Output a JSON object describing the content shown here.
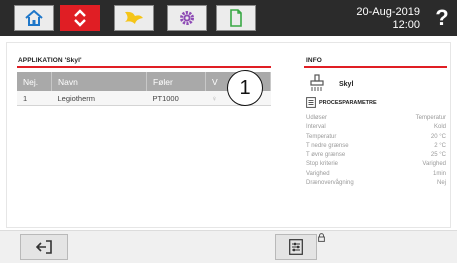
{
  "header": {
    "date": "20-Aug-2019",
    "time": "12:00",
    "help_label": "?",
    "tabs": [
      {
        "icon": "home-icon"
      },
      {
        "icon": "swap-arrows-icon",
        "active": true
      },
      {
        "icon": "flame-icon"
      },
      {
        "icon": "gear-icon"
      },
      {
        "icon": "document-icon"
      }
    ]
  },
  "applikation": {
    "title": "APPLIKATION 'Skyl'",
    "columns": [
      "Nej.",
      "Navn",
      "Føler",
      "V"
    ],
    "rows": [
      {
        "nej": "1",
        "navn": "Legiotherm",
        "foler": "PT1000",
        "v": "♀"
      }
    ],
    "callout": "1"
  },
  "info": {
    "title": "INFO",
    "name": "Skyl",
    "proc_title": "PROCESPARAMETRE",
    "params": [
      {
        "label": "Udløser",
        "value": "Temperatur"
      },
      {
        "label": "Interval",
        "value": "Kold"
      },
      {
        "label": "Temperatur",
        "value": "20 °C"
      },
      {
        "label": "T nedre grænse",
        "value": "2 °C"
      },
      {
        "label": "T øvre grænse",
        "value": "25 °C"
      },
      {
        "label": "Stop kriterie",
        "value": "Varighed"
      },
      {
        "label": "Varighed",
        "value": "1min"
      },
      {
        "label": "Drænovervågning",
        "value": "Nej"
      }
    ]
  },
  "colors": {
    "accent": "#e01e24",
    "topbar": "#2b2b2b"
  }
}
